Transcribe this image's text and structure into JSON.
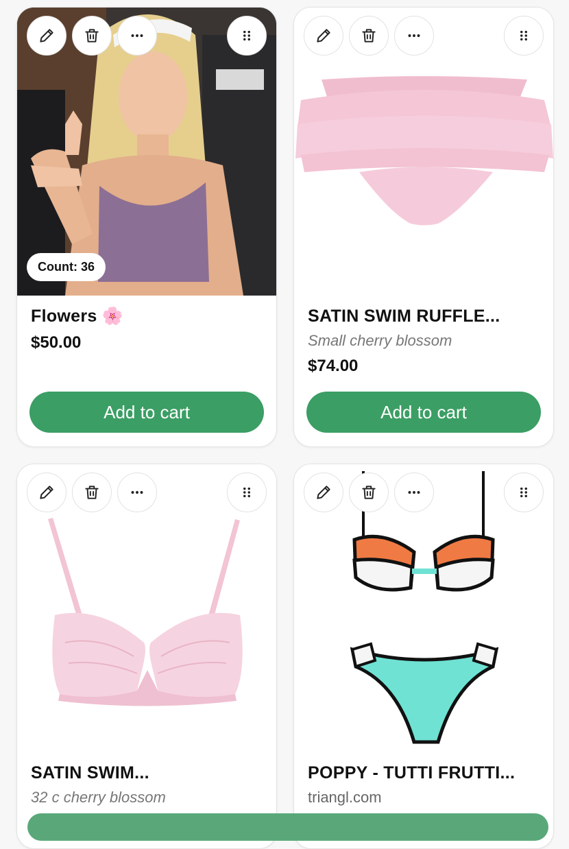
{
  "products": [
    {
      "title": "Flowers 🌸",
      "price": "$50.00",
      "count_label": "Count: 36",
      "cart_label": "Add to cart"
    },
    {
      "title": "SATIN SWIM RUFFLE...",
      "subtitle": "Small cherry blossom",
      "price": "$74.00",
      "cart_label": "Add to cart"
    },
    {
      "title": "SATIN SWIM...",
      "subtitle": "32 c cherry blossom"
    },
    {
      "title": "POPPY - TUTTI FRUTTI...",
      "site": "triangl.com"
    }
  ],
  "icons": {
    "edit": "pencil-icon",
    "delete": "trash-icon",
    "more": "more-horizontal-icon",
    "drag": "drag-handle-icon"
  },
  "colors": {
    "cart_button": "#3b9e64",
    "ruffle_pink": "#f4c6d6",
    "bra_pink": "#f6d3e0",
    "bikini_orange": "#f07a43",
    "bikini_aqua": "#6fe2d4"
  }
}
